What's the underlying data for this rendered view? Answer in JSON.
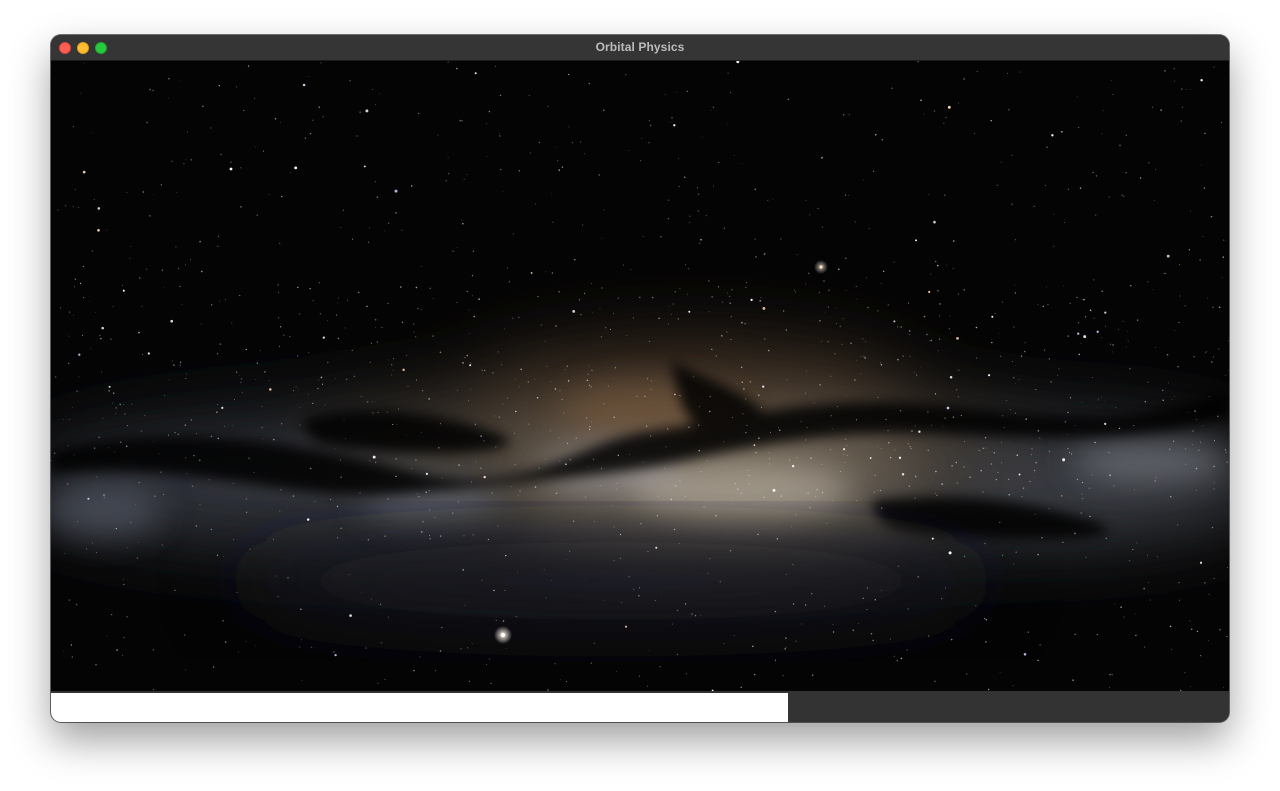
{
  "window": {
    "title": "Orbital Physics"
  },
  "titlebar": {
    "buttons": [
      "close",
      "minimize",
      "zoom"
    ]
  },
  "scene": {
    "background": "milky-way-starfield"
  },
  "progress": {
    "value": 0.626
  },
  "colors": {
    "titlebar": "#353535",
    "close": "#ff5f57",
    "minimize": "#febc2e",
    "zoom": "#28c840",
    "progress_fill": "#ffffff",
    "progress_track": "#333333"
  }
}
